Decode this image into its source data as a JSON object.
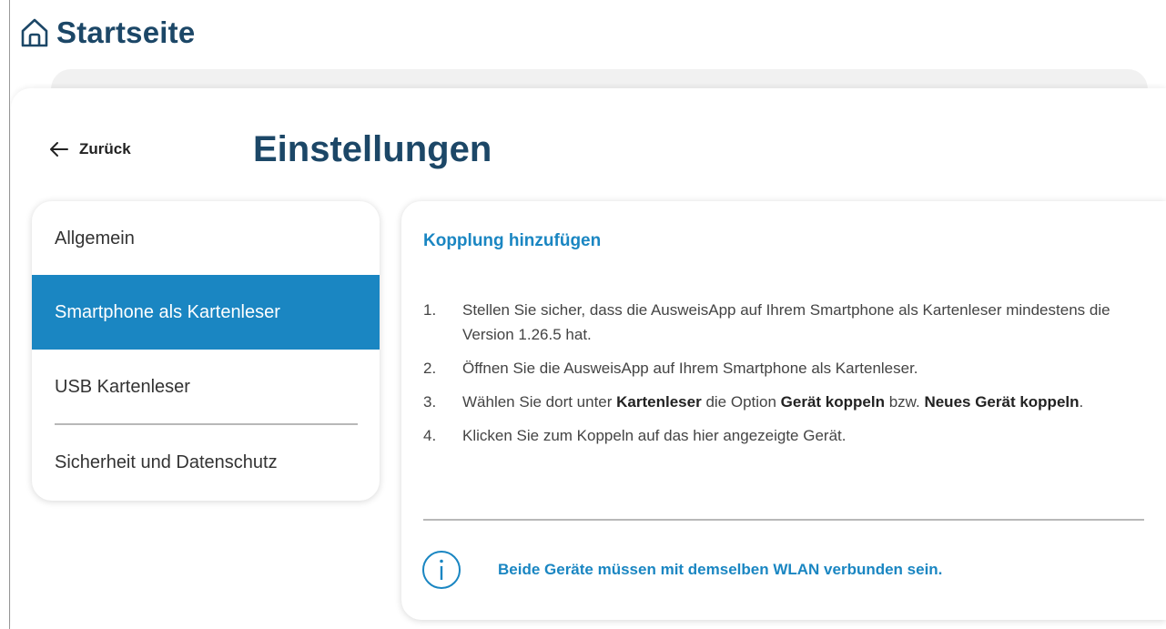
{
  "app": {
    "title": "Startseite",
    "home_icon": "home-icon"
  },
  "header": {
    "back_label": "Zurück",
    "back_icon": "arrow-left-icon",
    "page_title": "Einstellungen"
  },
  "sidebar": {
    "items": [
      {
        "label": "Allgemein",
        "active": false
      },
      {
        "label": "Smartphone als Kartenleser",
        "active": true
      },
      {
        "label": "USB Kartenleser",
        "active": false
      },
      {
        "label": "Sicherheit und Datenschutz",
        "active": false
      }
    ]
  },
  "content": {
    "title": "Kopplung hinzufügen",
    "steps": [
      {
        "number": "1.",
        "parts": [
          "Stellen Sie sicher, dass die AusweisApp auf Ihrem Smartphone als Kartenleser mindestens die Version 1.26.5 hat."
        ]
      },
      {
        "number": "2.",
        "parts": [
          "Öffnen Sie die AusweisApp auf Ihrem Smartphone als Kartenleser."
        ]
      },
      {
        "number": "3.",
        "parts": [
          "Wählen Sie dort unter ",
          "Kartenleser",
          " die Option ",
          "Gerät koppeln",
          " bzw. ",
          "Neues Gerät koppeln",
          "."
        ]
      },
      {
        "number": "4.",
        "parts": [
          "Klicken Sie zum Koppeln auf das hier angezeigte Gerät."
        ]
      }
    ],
    "info_icon": "info-icon",
    "info_text": "Beide Geräte müssen mit demselben WLAN verbunden sein."
  },
  "colors": {
    "brand_dark": "#1c4767",
    "accent": "#1a86c2"
  }
}
